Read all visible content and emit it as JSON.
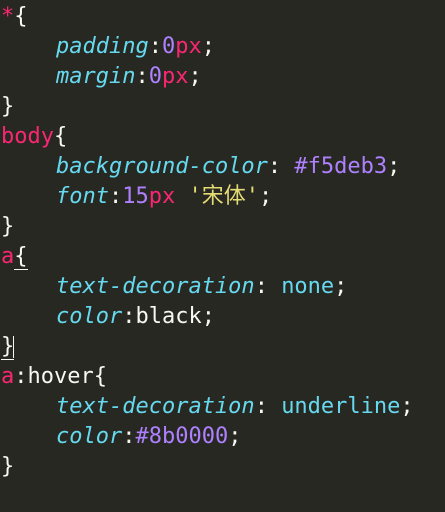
{
  "editor": {
    "lines": [
      {
        "tokens": [
          "*",
          "{"
        ]
      },
      {
        "tokens": [
          "padding",
          ":",
          "0",
          "px",
          ";"
        ]
      },
      {
        "tokens": [
          "margin",
          ":",
          "0",
          "px",
          ";"
        ]
      },
      {
        "tokens": [
          "}"
        ]
      },
      {
        "tokens": [
          "body",
          "{"
        ]
      },
      {
        "tokens": [
          "background-color",
          ": ",
          "#f5deb3",
          ";"
        ]
      },
      {
        "tokens": [
          "font",
          ":",
          "15",
          "px",
          " ",
          "'宋体'",
          ";"
        ]
      },
      {
        "tokens": [
          "}"
        ]
      },
      {
        "tokens": [
          "a",
          "{"
        ]
      },
      {
        "tokens": [
          "text-decoration",
          ": ",
          "none",
          ";"
        ]
      },
      {
        "tokens": [
          "color",
          ":",
          "black",
          ";"
        ]
      },
      {
        "tokens": [
          "}"
        ]
      },
      {
        "tokens": [
          "a",
          ":hover",
          "{"
        ]
      },
      {
        "tokens": [
          "text-decoration",
          ": ",
          "underline",
          ";"
        ]
      },
      {
        "tokens": [
          "color",
          ":",
          "#8b0000",
          ";"
        ]
      },
      {
        "tokens": [
          "}"
        ]
      }
    ]
  },
  "colors": {
    "background": "#272822",
    "selector": "#f92672",
    "property": "#66d9ef",
    "number": "#ae81ff",
    "string": "#e6db74",
    "text": "#f8f8f2"
  }
}
